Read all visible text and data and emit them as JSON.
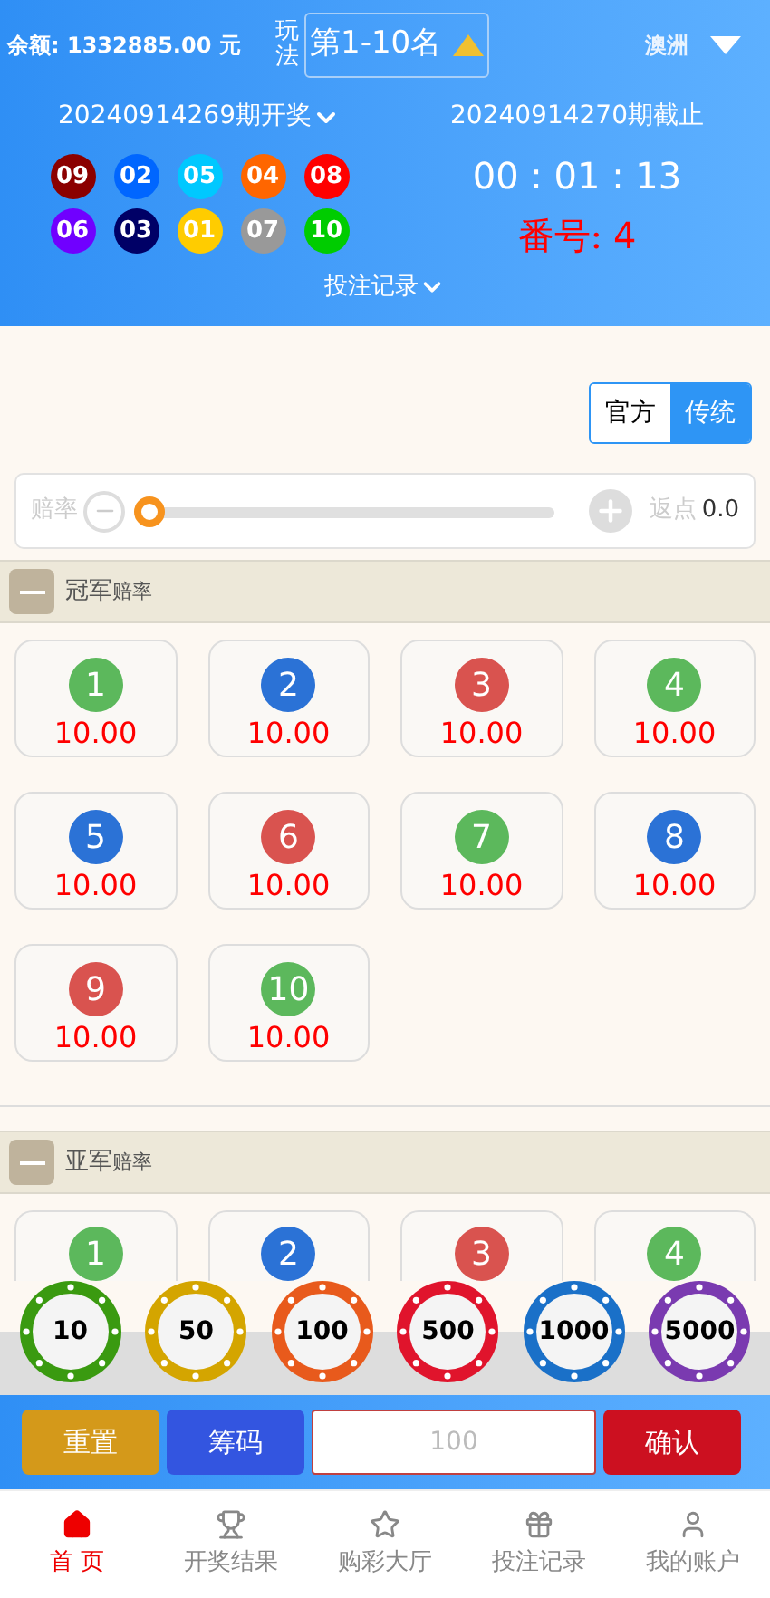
{
  "header": {
    "balance": "余额: 1332885.00 元",
    "play_label": "玩法",
    "play_select": "第1-10名",
    "region": "澳洲",
    "last_issue": "20240914269期开奖",
    "next_issue": "20240914270期截止",
    "countdown": "00 : 01 : 13",
    "number_label": "番号:",
    "number_value": "4",
    "records_link": "投注记录",
    "balls": [
      {
        "text": "09",
        "color": "#8b0000"
      },
      {
        "text": "02",
        "color": "#0066ff"
      },
      {
        "text": "05",
        "color": "#00c8ff"
      },
      {
        "text": "04",
        "color": "#ff6600"
      },
      {
        "text": "08",
        "color": "#ff0000"
      },
      {
        "text": "06",
        "color": "#7000ff"
      },
      {
        "text": "03",
        "color": "#000066"
      },
      {
        "text": "01",
        "color": "#ffcc00"
      },
      {
        "text": "07",
        "color": "#999999"
      },
      {
        "text": "10",
        "color": "#00cc00"
      }
    ]
  },
  "mode_tabs": [
    {
      "label": "官方",
      "selected": false
    },
    {
      "label": "传统",
      "selected": true
    }
  ],
  "odds_slider": {
    "label": "赔率",
    "level": 0,
    "rebate_label": "返点",
    "rebate_value": "0.0"
  },
  "sections": [
    {
      "title": "冠军",
      "suffix": "赔率",
      "items": [
        {
          "kind": "full",
          "number": "1",
          "odds": "10.00",
          "color": "#5cb85c"
        },
        {
          "kind": "full",
          "number": "2",
          "odds": "10.00",
          "color": "#2b72d6"
        },
        {
          "kind": "full",
          "number": "3",
          "odds": "10.00",
          "color": "#d9534f"
        },
        {
          "kind": "full",
          "number": "4",
          "odds": "10.00",
          "color": "#5cb85c"
        },
        {
          "kind": "full",
          "number": "5",
          "odds": "10.00",
          "color": "#2b72d6"
        },
        {
          "kind": "full",
          "number": "6",
          "odds": "10.00",
          "color": "#d9534f"
        },
        {
          "kind": "full",
          "number": "7",
          "odds": "10.00",
          "color": "#5cb85c"
        },
        {
          "kind": "full",
          "number": "8",
          "odds": "10.00",
          "color": "#2b72d6"
        },
        {
          "kind": "full",
          "number": "9",
          "odds": "10.00",
          "color": "#d9534f"
        },
        {
          "kind": "full",
          "number": "10",
          "odds": "10.00",
          "color": "#5cb85c"
        }
      ]
    },
    {
      "title": "亚军",
      "suffix": "赔率",
      "items": [
        {
          "kind": "cut",
          "number": "1",
          "color": "#5cb85c"
        },
        {
          "kind": "cut",
          "number": "2",
          "color": "#2b72d6"
        },
        {
          "kind": "cut",
          "number": "3",
          "color": "#d9534f"
        },
        {
          "kind": "cut",
          "number": "4",
          "color": "#5cb85c"
        }
      ]
    }
  ],
  "chips": [
    {
      "label": "10",
      "color": "#3a9a10"
    },
    {
      "label": "50",
      "color": "#d4a500"
    },
    {
      "label": "100",
      "color": "#e85a1c"
    },
    {
      "label": "500",
      "color": "#e0142c"
    },
    {
      "label": "1000",
      "color": "#1a70c8"
    },
    {
      "label": "5000",
      "color": "#7a3ab0"
    }
  ],
  "actions": {
    "reset": "重置",
    "chips": "筹码",
    "amount_placeholder": "100",
    "confirm": "确认"
  },
  "tabbar": [
    {
      "label": "首 页",
      "selected": true
    },
    {
      "label": "开奖结果",
      "selected": false
    },
    {
      "label": "购彩大厅",
      "selected": false
    },
    {
      "label": "投注记录",
      "selected": false
    },
    {
      "label": "我的账户",
      "selected": false
    }
  ]
}
